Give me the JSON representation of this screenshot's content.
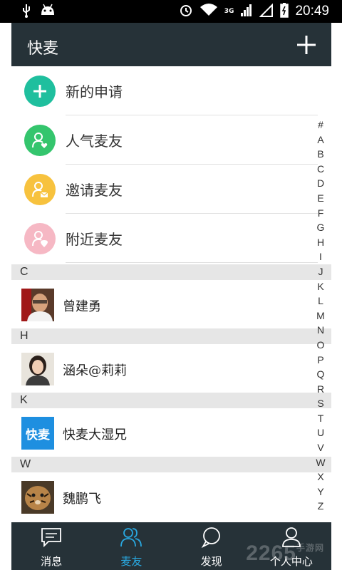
{
  "status_bar": {
    "time": "20:49",
    "network": "3G"
  },
  "app_bar": {
    "title": "快麦",
    "add_icon": "plus-icon"
  },
  "functions": [
    {
      "label": "新的申请",
      "icon": "plus-icon",
      "color": "#1fbf9e"
    },
    {
      "label": "人气麦友",
      "icon": "user-heart-icon",
      "color": "#34c56d"
    },
    {
      "label": "邀请麦友",
      "icon": "user-mail-icon",
      "color": "#f7c23e"
    },
    {
      "label": "附近麦友",
      "icon": "user-location-icon",
      "color": "#f6b8c4"
    }
  ],
  "sections": [
    {
      "letter": "C",
      "contacts": [
        {
          "name": "曾建勇"
        }
      ]
    },
    {
      "letter": "H",
      "contacts": [
        {
          "name": "涵朵@莉莉"
        }
      ]
    },
    {
      "letter": "K",
      "contacts": [
        {
          "name": "快麦大湿兄",
          "logo_text": "快麦"
        }
      ]
    },
    {
      "letter": "W",
      "contacts": [
        {
          "name": "魏鹏飞"
        }
      ]
    }
  ],
  "index_letters": [
    "#",
    "A",
    "B",
    "C",
    "D",
    "E",
    "F",
    "G",
    "H",
    "I",
    "J",
    "K",
    "L",
    "M",
    "N",
    "O",
    "P",
    "Q",
    "R",
    "S",
    "T",
    "U",
    "V",
    "W",
    "X",
    "Y",
    "Z"
  ],
  "tabs": [
    {
      "label": "消息",
      "icon": "message-icon",
      "active": false
    },
    {
      "label": "麦友",
      "icon": "friends-icon",
      "active": true
    },
    {
      "label": "发现",
      "icon": "discover-icon",
      "active": false
    },
    {
      "label": "个人中心",
      "icon": "profile-icon",
      "active": false
    }
  ],
  "watermark": {
    "text": "2265",
    "sub": "手游网"
  },
  "colors": {
    "app_bar": "#263238",
    "active_tab": "#29a8e0",
    "section_bg": "#e6e6e6"
  }
}
